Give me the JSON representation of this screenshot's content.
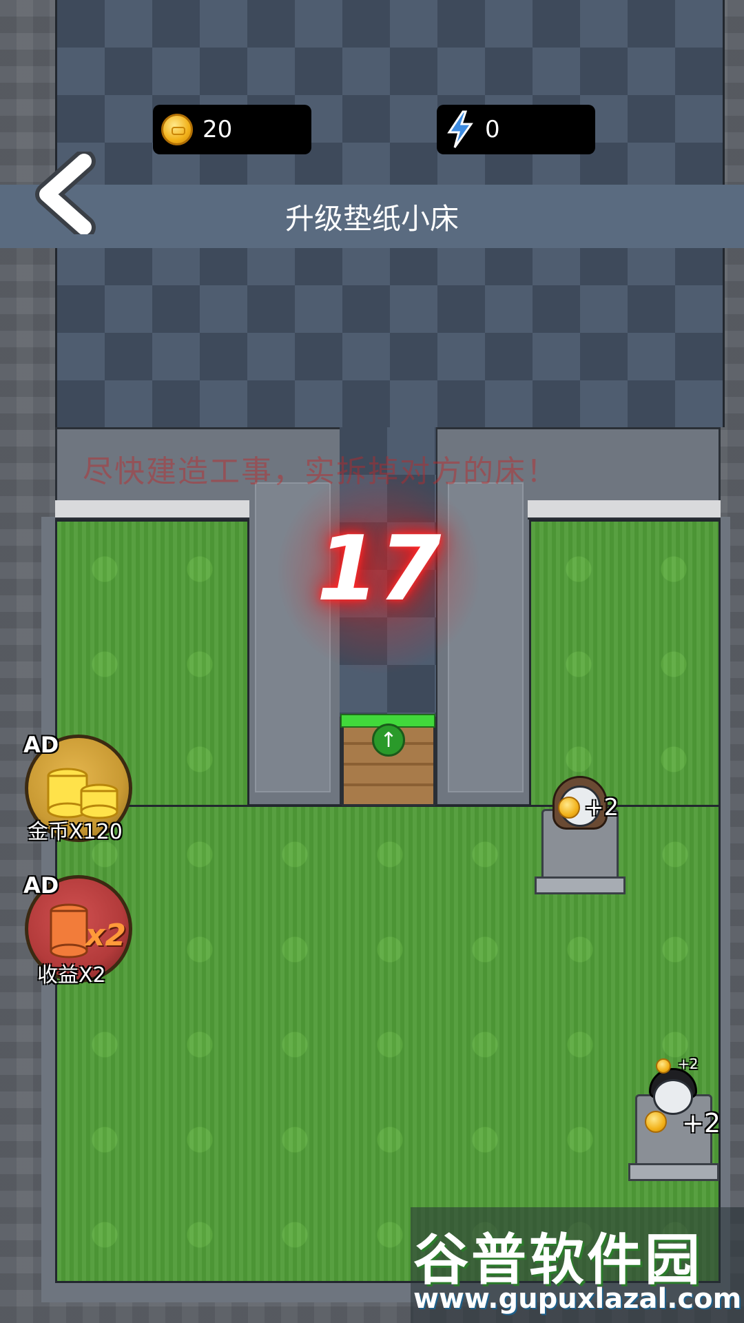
{
  "resources": {
    "coins": "20",
    "energy": "0",
    "coin_icon": "coin-icon",
    "energy_icon": "lightning-icon"
  },
  "header": {
    "title": "升级垫纸小床",
    "back_icon": "back-chevron-icon"
  },
  "game": {
    "countdown": "17",
    "hint": "尽快建造工事，实拆掉对方的床！",
    "door_hp_fraction": 1.0,
    "door_upgrade_icon": "up-arrow-icon"
  },
  "ads": {
    "coins_ad": {
      "tag": "AD",
      "label": "金币X120",
      "icon": "coin-stack-icon",
      "color": "#c99a33"
    },
    "income_ad": {
      "tag": "AD",
      "label": "收益X2",
      "icon": "x2-coins-icon",
      "badge": "x2",
      "color": "#b33b3b"
    }
  },
  "beds": [
    {
      "income": "+2",
      "character": "girl"
    },
    {
      "income": "+2",
      "income_small": "+2",
      "character": "boy"
    }
  ],
  "watermark": {
    "title": "谷普软件园",
    "url": "www.gupuxlazal.com"
  }
}
